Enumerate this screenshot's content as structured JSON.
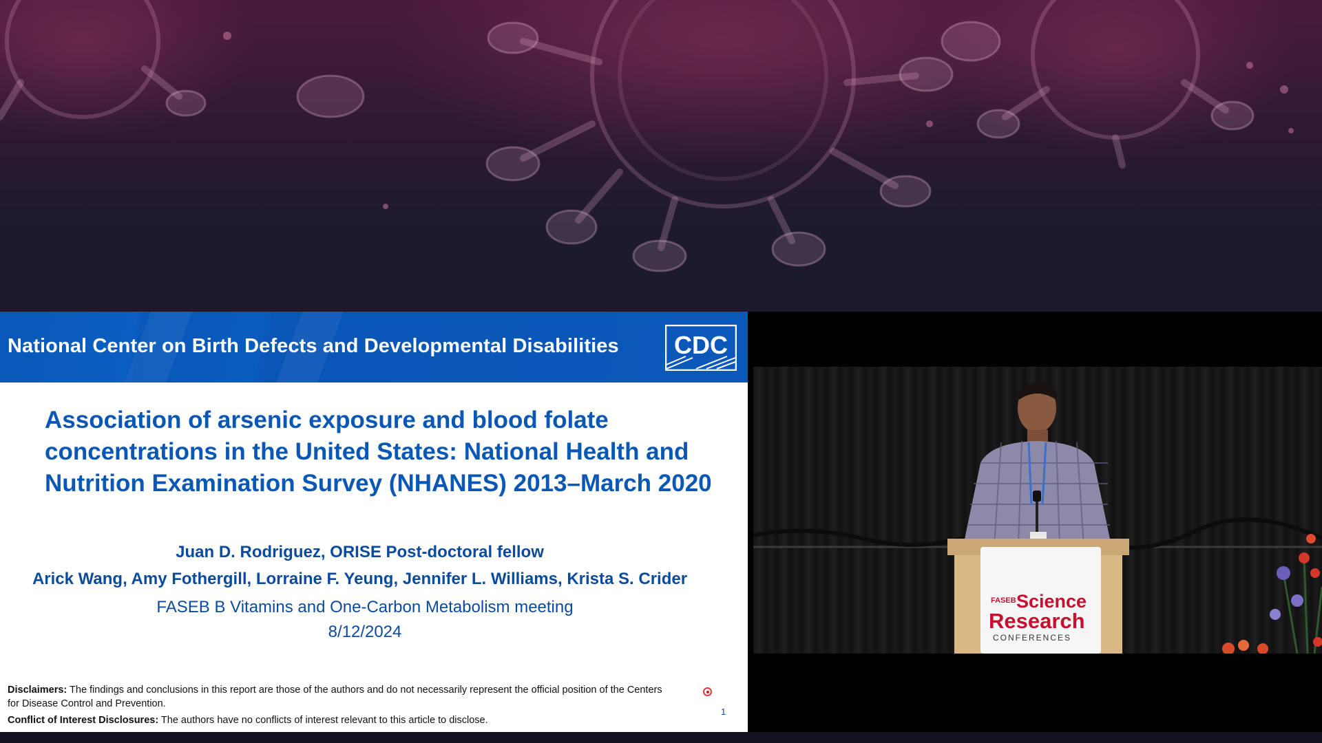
{
  "slide": {
    "header_title": "National Center on Birth Defects and Developmental Disabilities",
    "logo_text": "CDC",
    "title_lines": [
      "Association of arsenic exposure and blood folate",
      "concentrations in the United States: National Health and",
      "Nutrition Examination Survey (NHANES) 2013–March 2020"
    ],
    "presenter": "Juan D. Rodriguez, ORISE Post-doctoral fellow",
    "coauthors": "Arick Wang, Amy Fothergill, Lorraine F. Yeung, Jennifer L. Williams, Krista S. Crider",
    "meeting": "FASEB B Vitamins and One-Carbon Metabolism meeting",
    "date": "8/12/2024",
    "disclaimer_label": "Disclaimers:",
    "disclaimer_text": " The findings and conclusions in this report are those of the authors and do not necessarily represent the official position of the Centers for Disease Control and Prevention.",
    "coi_label": "Conflict of Interest Disclosures:",
    "coi_text": " The authors have no conflicts of interest relevant to this article to disclose.",
    "slide_number": "1"
  },
  "video": {
    "podium_brand_small": "FASEB",
    "podium_brand_line1": "Science",
    "podium_brand_line2": "Research",
    "podium_brand_line3": "CONFERENCES"
  },
  "colors": {
    "header_blue": "#0b58ba",
    "title_blue": "#0b57b6",
    "text_blue": "#0b4a9c",
    "banner_dark": "#1b1a2d",
    "podium_red": "#c8102e"
  },
  "icons": [
    "cdc-logo-icon",
    "laser-pointer-icon",
    "virus-background-illustration"
  ]
}
